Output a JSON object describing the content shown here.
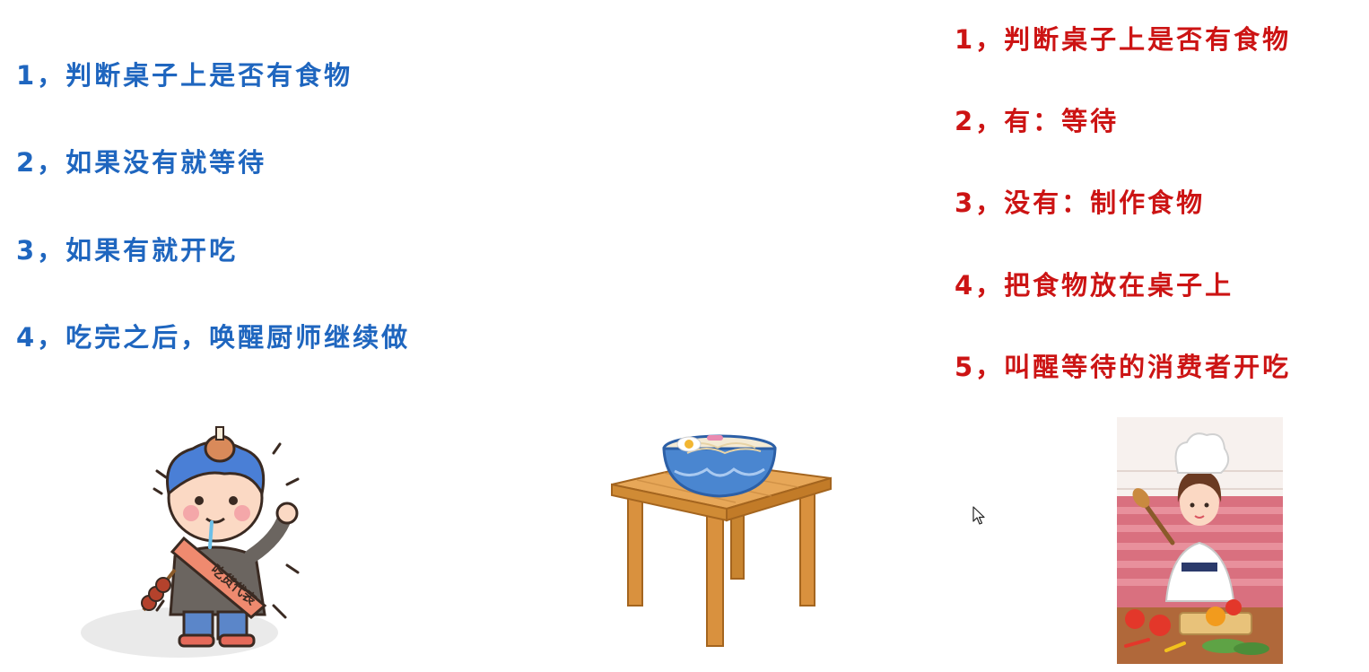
{
  "consumer": {
    "steps": [
      "1，判断桌子上是否有食物",
      "2，如果没有就等待",
      "3，如果有就开吃",
      "4，吃完之后，唤醒厨师继续做"
    ],
    "color": "#1f66bf",
    "icon": "hungry-foodie-icon",
    "sash_text": "吃货代表"
  },
  "table": {
    "icon": "table-with-noodle-bowl-icon"
  },
  "producer": {
    "steps": [
      "1，判断桌子上是否有食物",
      "2，有：等待",
      "3，没有：制作食物",
      "4，把食物放在桌子上",
      "5，叫醒等待的消费者开吃"
    ],
    "color": "#cc1414",
    "icon": "chef-icon"
  },
  "cursor": {
    "icon": "mouse-pointer-icon"
  }
}
